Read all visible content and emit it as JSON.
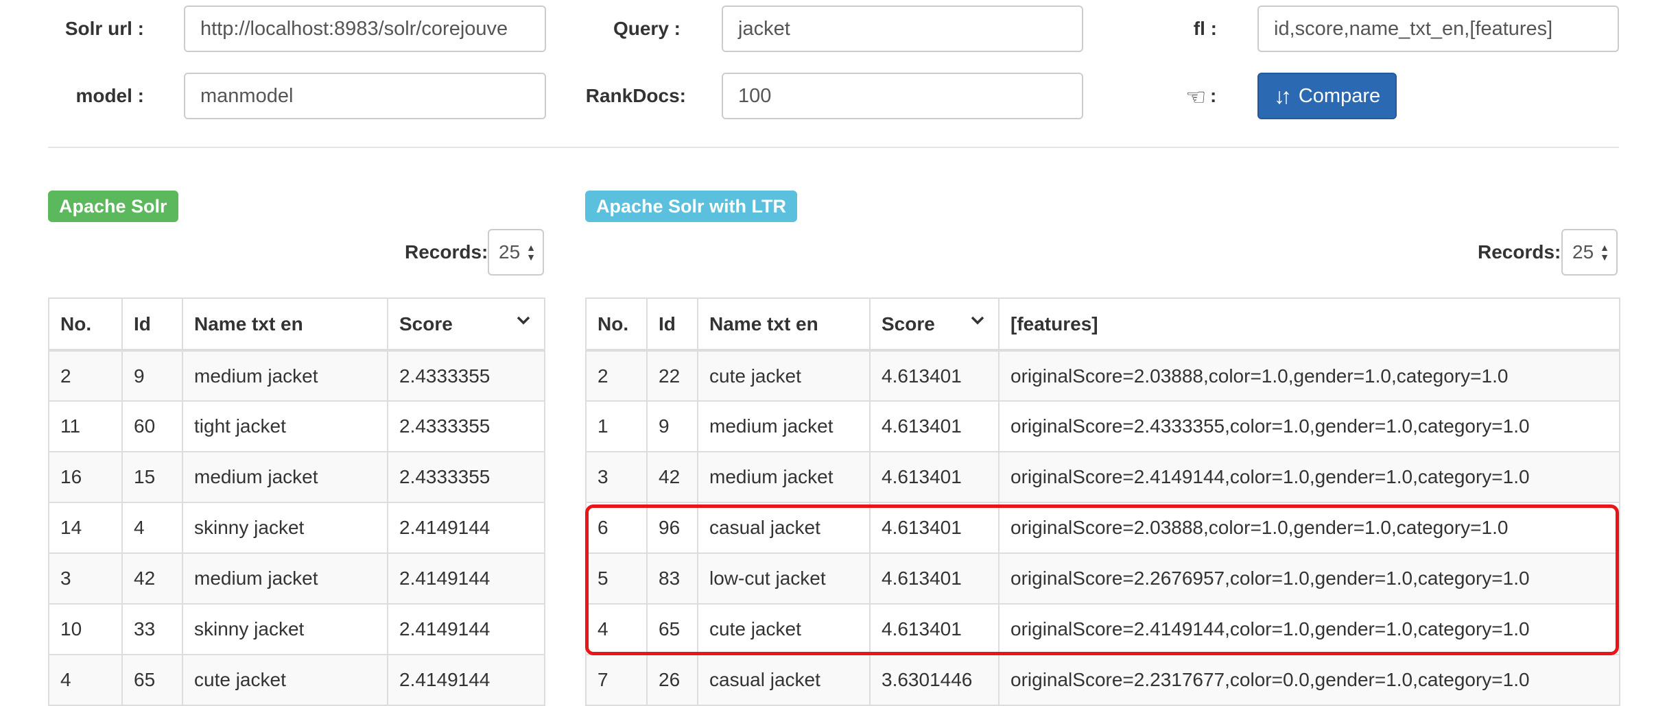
{
  "form": {
    "solr_url_label": "Solr url :",
    "solr_url_value": "http://localhost:8983/solr/corejouve",
    "query_label": "Query :",
    "query_value": "jacket",
    "fl_label": "fl :",
    "fl_value": "id,score,name_txt_en,[features]",
    "model_label": "model :",
    "model_value": "manmodel",
    "rankdocs_label": "RankDocs:",
    "rankdocs_value": "100",
    "compare_colon": ":",
    "compare_label": "Compare",
    "icons": {
      "compare_hand": "pointing-hand-icon",
      "compare_sort": "sort-arrows-icon"
    }
  },
  "left": {
    "badge": "Apache Solr",
    "badge_color": "#5cb85c",
    "records_label": "Records:",
    "records_value": "25",
    "columns": [
      "No.",
      "Id",
      "Name txt en",
      "Score"
    ],
    "sorted_column": "Score",
    "rows": [
      [
        "2",
        "9",
        "medium jacket",
        "2.4333355"
      ],
      [
        "11",
        "60",
        "tight jacket",
        "2.4333355"
      ],
      [
        "16",
        "15",
        "medium jacket",
        "2.4333355"
      ],
      [
        "14",
        "4",
        "skinny jacket",
        "2.4149144"
      ],
      [
        "3",
        "42",
        "medium jacket",
        "2.4149144"
      ],
      [
        "10",
        "33",
        "skinny jacket",
        "2.4149144"
      ],
      [
        "4",
        "65",
        "cute jacket",
        "2.4149144"
      ]
    ]
  },
  "right": {
    "badge": "Apache Solr with LTR",
    "badge_color": "#5bc0de",
    "records_label": "Records:",
    "records_value": "25",
    "columns": [
      "No.",
      "Id",
      "Name txt en",
      "Score",
      "[features]"
    ],
    "sorted_column": "Score",
    "highlight_color": "#e8161b",
    "rows": [
      [
        "2",
        "22",
        "cute jacket",
        "4.613401",
        "originalScore=2.03888,color=1.0,gender=1.0,category=1.0"
      ],
      [
        "1",
        "9",
        "medium jacket",
        "4.613401",
        "originalScore=2.4333355,color=1.0,gender=1.0,category=1.0"
      ],
      [
        "3",
        "42",
        "medium jacket",
        "4.613401",
        "originalScore=2.4149144,color=1.0,gender=1.0,category=1.0"
      ],
      [
        "6",
        "96",
        "casual jacket",
        "4.613401",
        "originalScore=2.03888,color=1.0,gender=1.0,category=1.0"
      ],
      [
        "5",
        "83",
        "low-cut jacket",
        "4.613401",
        "originalScore=2.2676957,color=1.0,gender=1.0,category=1.0"
      ],
      [
        "4",
        "65",
        "cute jacket",
        "4.613401",
        "originalScore=2.4149144,color=1.0,gender=1.0,category=1.0"
      ],
      [
        "7",
        "26",
        "casual jacket",
        "3.6301446",
        "originalScore=2.2317677,color=0.0,gender=1.0,category=1.0"
      ]
    ]
  }
}
